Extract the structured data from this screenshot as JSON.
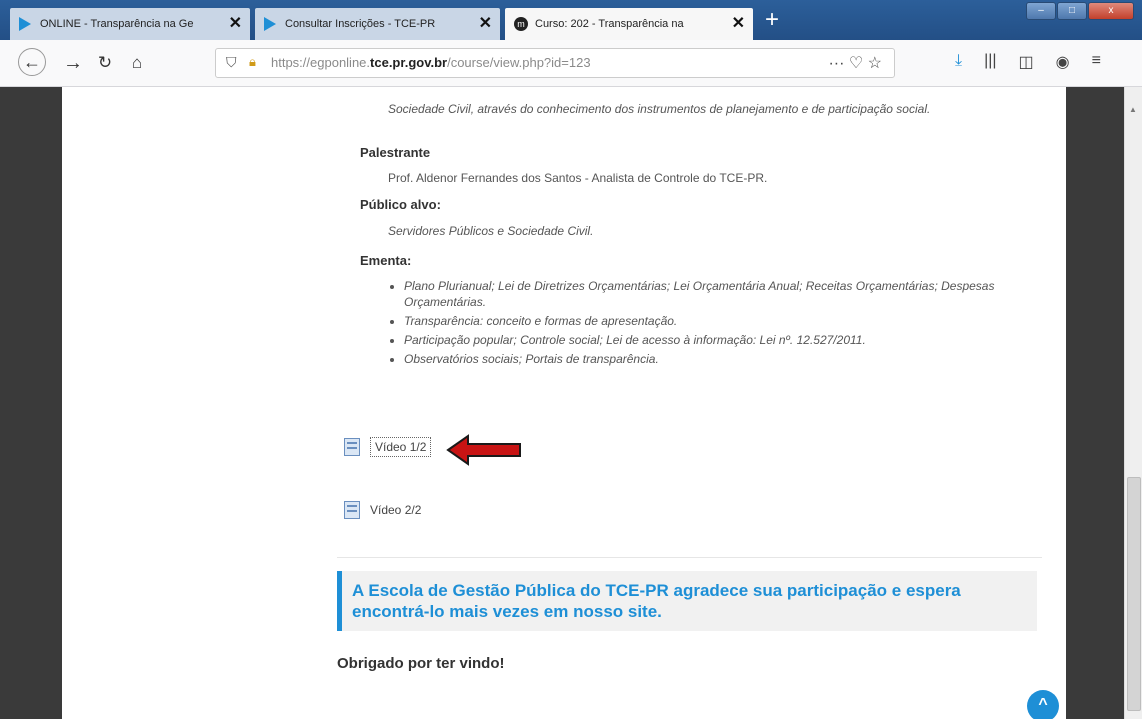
{
  "browser": {
    "tabs": [
      {
        "label": "ONLINE - Transparência na Ge",
        "icon": "tce-favicon-icon"
      },
      {
        "label": "Consultar Inscrições - TCE-PR",
        "icon": "tce-favicon-icon"
      },
      {
        "label": "Curso: 202 - Transparência na",
        "icon": "moodle-favicon-icon"
      }
    ],
    "close_glyph": "✕",
    "new_tab_glyph": "+",
    "url_prefix": "https://egponline.",
    "url_domain": "tce.pr.gov.br",
    "url_path": "/course/view.php?id=123",
    "url_actions": "··· ♡ ☆",
    "window_controls": [
      "–",
      "□",
      "x"
    ]
  },
  "content": {
    "description_tail": "Sociedade Civil, através do conhecimento dos instrumentos de planejamento e de participação social.",
    "palestrante_heading": "Palestrante",
    "palestrante_text": "Prof. Aldenor Fernandes dos Santos - Analista de Controle do TCE-PR.",
    "publico_heading": "Público alvo:",
    "publico_text": "Servidores Públicos e Sociedade Civil.",
    "ementa_heading": "Ementa:",
    "ementa_items": [
      "Plano Plurianual; Lei de Diretrizes Orçamentárias; Lei Orçamentária Anual; Receitas Orçamentárias; Despesas Orçamentárias.",
      "Transparência: conceito e formas de apresentação.",
      "Participação popular; Controle social; Lei de acesso à informação: Lei nº. 12.527/2011.",
      "Observatórios sociais; Portais de transparência."
    ],
    "resources": [
      {
        "label": "Vídeo 1/2"
      },
      {
        "label": "Vídeo 2/2"
      }
    ],
    "callout": "A Escola de Gestão Pública do TCE-PR agradece sua participação e espera encontrá-lo mais vezes em nosso site.",
    "thanks": "Obrigado por ter vindo!"
  },
  "colors": {
    "accent": "#1e8fd6",
    "arrow": "#c81414"
  }
}
